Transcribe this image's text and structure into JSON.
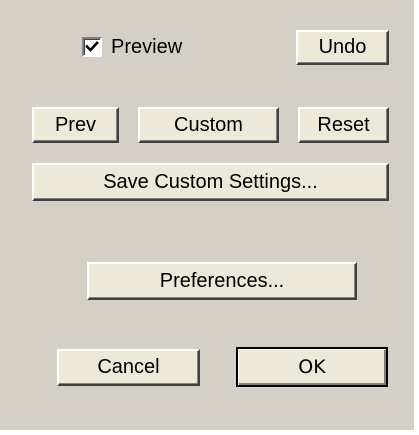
{
  "dialog": {
    "preview": {
      "label": "Preview",
      "checked": true
    },
    "buttons": {
      "undo": "Undo",
      "prev": "Prev",
      "custom": "Custom",
      "reset": "Reset",
      "save_custom_settings": "Save Custom Settings...",
      "preferences": "Preferences...",
      "cancel": "Cancel",
      "ok": "OK"
    },
    "colors": {
      "panel_background": "#d4d0c8",
      "button_face": "#ece9d8",
      "text": "#000000"
    },
    "icons": {
      "preview_check": "checkmark-icon"
    }
  }
}
